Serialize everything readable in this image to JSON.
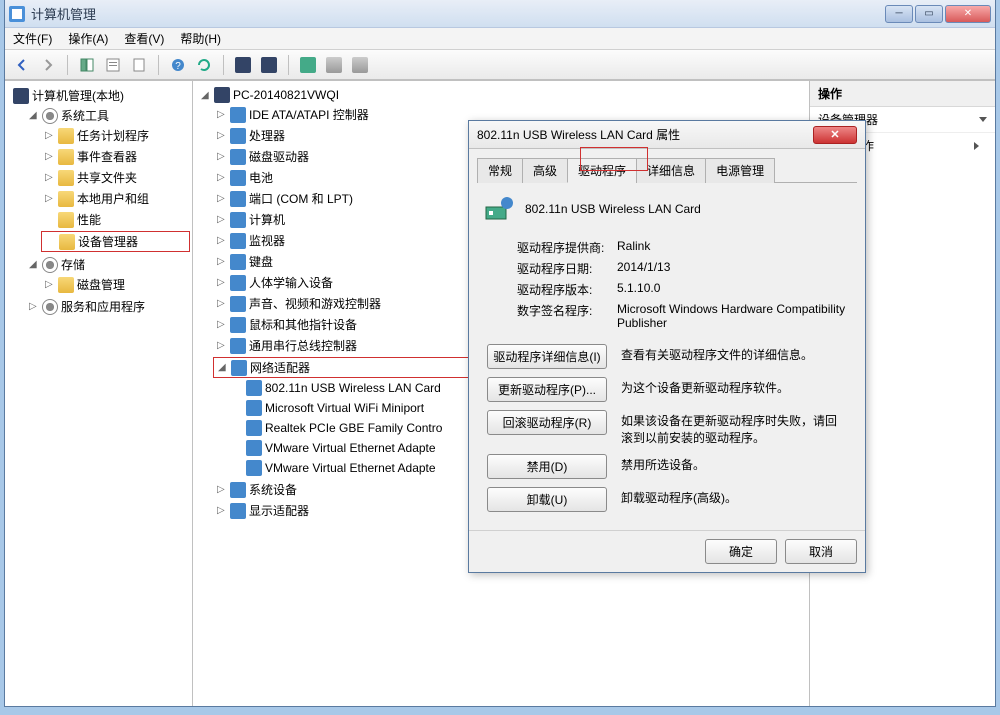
{
  "window": {
    "title": "计算机管理"
  },
  "menubar": [
    "文件(F)",
    "操作(A)",
    "查看(V)",
    "帮助(H)"
  ],
  "leftTree": {
    "root": "计算机管理(本地)",
    "groups": [
      {
        "label": "系统工具",
        "expanded": true,
        "children": [
          "任务计划程序",
          "事件查看器",
          "共享文件夹",
          "本地用户和组",
          "性能",
          "设备管理器"
        ]
      },
      {
        "label": "存储",
        "expanded": true,
        "children": [
          "磁盘管理"
        ]
      },
      {
        "label": "服务和应用程序",
        "expanded": false,
        "children": []
      }
    ]
  },
  "centerTree": {
    "root": "PC-20140821VWQI",
    "categories": [
      {
        "label": "IDE ATA/ATAPI 控制器",
        "expanded": false
      },
      {
        "label": "处理器",
        "expanded": false
      },
      {
        "label": "磁盘驱动器",
        "expanded": false
      },
      {
        "label": "电池",
        "expanded": false
      },
      {
        "label": "端口 (COM 和 LPT)",
        "expanded": false
      },
      {
        "label": "计算机",
        "expanded": false
      },
      {
        "label": "监视器",
        "expanded": false
      },
      {
        "label": "键盘",
        "expanded": false
      },
      {
        "label": "人体学输入设备",
        "expanded": false
      },
      {
        "label": "声音、视频和游戏控制器",
        "expanded": false
      },
      {
        "label": "鼠标和其他指针设备",
        "expanded": false
      },
      {
        "label": "通用串行总线控制器",
        "expanded": false
      },
      {
        "label": "网络适配器",
        "expanded": true,
        "devices": [
          "802.11n USB Wireless LAN Card",
          "Microsoft Virtual WiFi Miniport",
          "Realtek PCIe GBE Family Contro",
          "VMware Virtual Ethernet Adapte",
          "VMware Virtual Ethernet Adapte"
        ]
      },
      {
        "label": "系统设备",
        "expanded": false
      },
      {
        "label": "显示适配器",
        "expanded": false
      }
    ]
  },
  "rightPane": {
    "header": "操作",
    "section": "设备管理器",
    "items": [
      "更多操作"
    ]
  },
  "dialog": {
    "title": "802.11n USB Wireless LAN Card 属性",
    "tabs": [
      "常规",
      "高级",
      "驱动程序",
      "详细信息",
      "电源管理"
    ],
    "activeTab": 2,
    "deviceName": "802.11n USB Wireless LAN Card",
    "info": [
      {
        "k": "驱动程序提供商:",
        "v": "Ralink"
      },
      {
        "k": "驱动程序日期:",
        "v": "2014/1/13"
      },
      {
        "k": "驱动程序版本:",
        "v": "5.1.10.0"
      },
      {
        "k": "数字签名程序:",
        "v": "Microsoft Windows Hardware Compatibility Publisher"
      }
    ],
    "buttons": [
      {
        "label": "驱动程序详细信息(I)",
        "desc": "查看有关驱动程序文件的详细信息。"
      },
      {
        "label": "更新驱动程序(P)...",
        "desc": "为这个设备更新驱动程序软件。"
      },
      {
        "label": "回滚驱动程序(R)",
        "desc": "如果该设备在更新驱动程序时失败，请回滚到以前安装的驱动程序。"
      },
      {
        "label": "禁用(D)",
        "desc": "禁用所选设备。"
      },
      {
        "label": "卸载(U)",
        "desc": "卸载驱动程序(高级)。"
      }
    ],
    "footer": {
      "ok": "确定",
      "cancel": "取消"
    }
  }
}
